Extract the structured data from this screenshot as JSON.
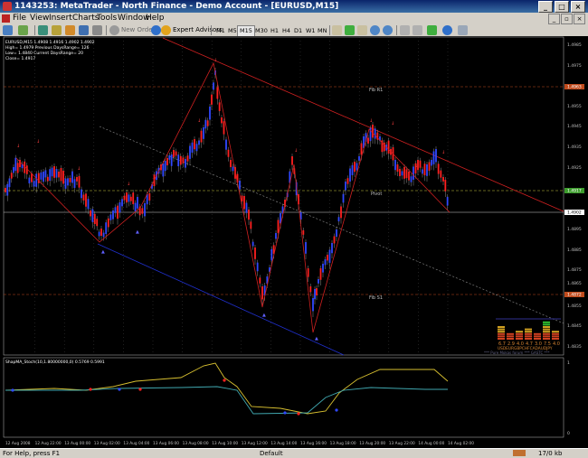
{
  "window": {
    "title": "1143253: MetaTrader - North Finance - Demo Account - [EURUSD,M15]",
    "controls": [
      "_",
      "□",
      "×"
    ]
  },
  "menu": {
    "items": [
      "File",
      "View",
      "Insert",
      "Charts",
      "Tools",
      "Window",
      "Help"
    ],
    "mdi_controls": [
      "_",
      "▫",
      "×"
    ]
  },
  "toolbar": {
    "new_order_label": "New Order",
    "expert_advisors_label": "Expert Advisors",
    "timeframes": [
      "M1",
      "M5",
      "M15",
      "M30",
      "H1",
      "H4",
      "D1",
      "W1",
      "MN"
    ],
    "active_timeframe": "M15"
  },
  "chart": {
    "info_lines": [
      "EURUSD,M15  1.4908 1.4916 1.4902 1.4902",
      "High= 1.4979 Previous DaysRange= 126",
      "Low= 1.4840 Current DaysRange= 20",
      "Close= 1.4917"
    ],
    "price_labels": [
      "1.4985",
      "1.4975",
      "1.4965",
      "1.4955",
      "1.4945",
      "1.4935",
      "1.4925",
      "1.4915",
      "1.4905",
      "1.4895",
      "1.4885",
      "1.4875",
      "1.4865",
      "1.4855",
      "1.4845",
      "1.4835"
    ],
    "level_tags": [
      {
        "price": "1.4963",
        "color": "#c04a1c"
      },
      {
        "price": "1.4917",
        "color": "#3c9c2c"
      },
      {
        "price": "1.4902",
        "color": "#ffffff"
      },
      {
        "price": "1.4872",
        "color": "#c04a1c"
      }
    ],
    "level_labels": [
      "Fib R1",
      "Pivot",
      "Fib S1"
    ],
    "strength_meter": {
      "values": [
        "6.7",
        "2.9",
        "4.0",
        "4.7",
        "3.0",
        "7.5",
        "4.0"
      ],
      "currencies": "USDEURGBPCHFCADAUDJPY",
      "caption": "*** Pure Mokas forum *** GASTC ***"
    },
    "indicator": {
      "label": "ShapMA_Stoch(10,1.80000000,0) 0.5769 0.5991",
      "scale_top": "1",
      "scale_bottom": "0"
    },
    "time_labels": [
      "12 Aug 2008",
      "12 Aug 22:00",
      "13 Aug 00:00",
      "13 Aug 02:00",
      "13 Aug 04:00",
      "13 Aug 06:00",
      "13 Aug 08:00",
      "13 Aug 10:00",
      "13 Aug 12:00",
      "13 Aug 14:00",
      "13 Aug 16:00",
      "13 Aug 18:00",
      "13 Aug 20:00",
      "13 Aug 22:00",
      "14 Aug 00:00",
      "14 Aug 02:00"
    ]
  },
  "status": {
    "help": "For Help, press F1",
    "profile": "Default",
    "traffic": "17/0 kb"
  }
}
